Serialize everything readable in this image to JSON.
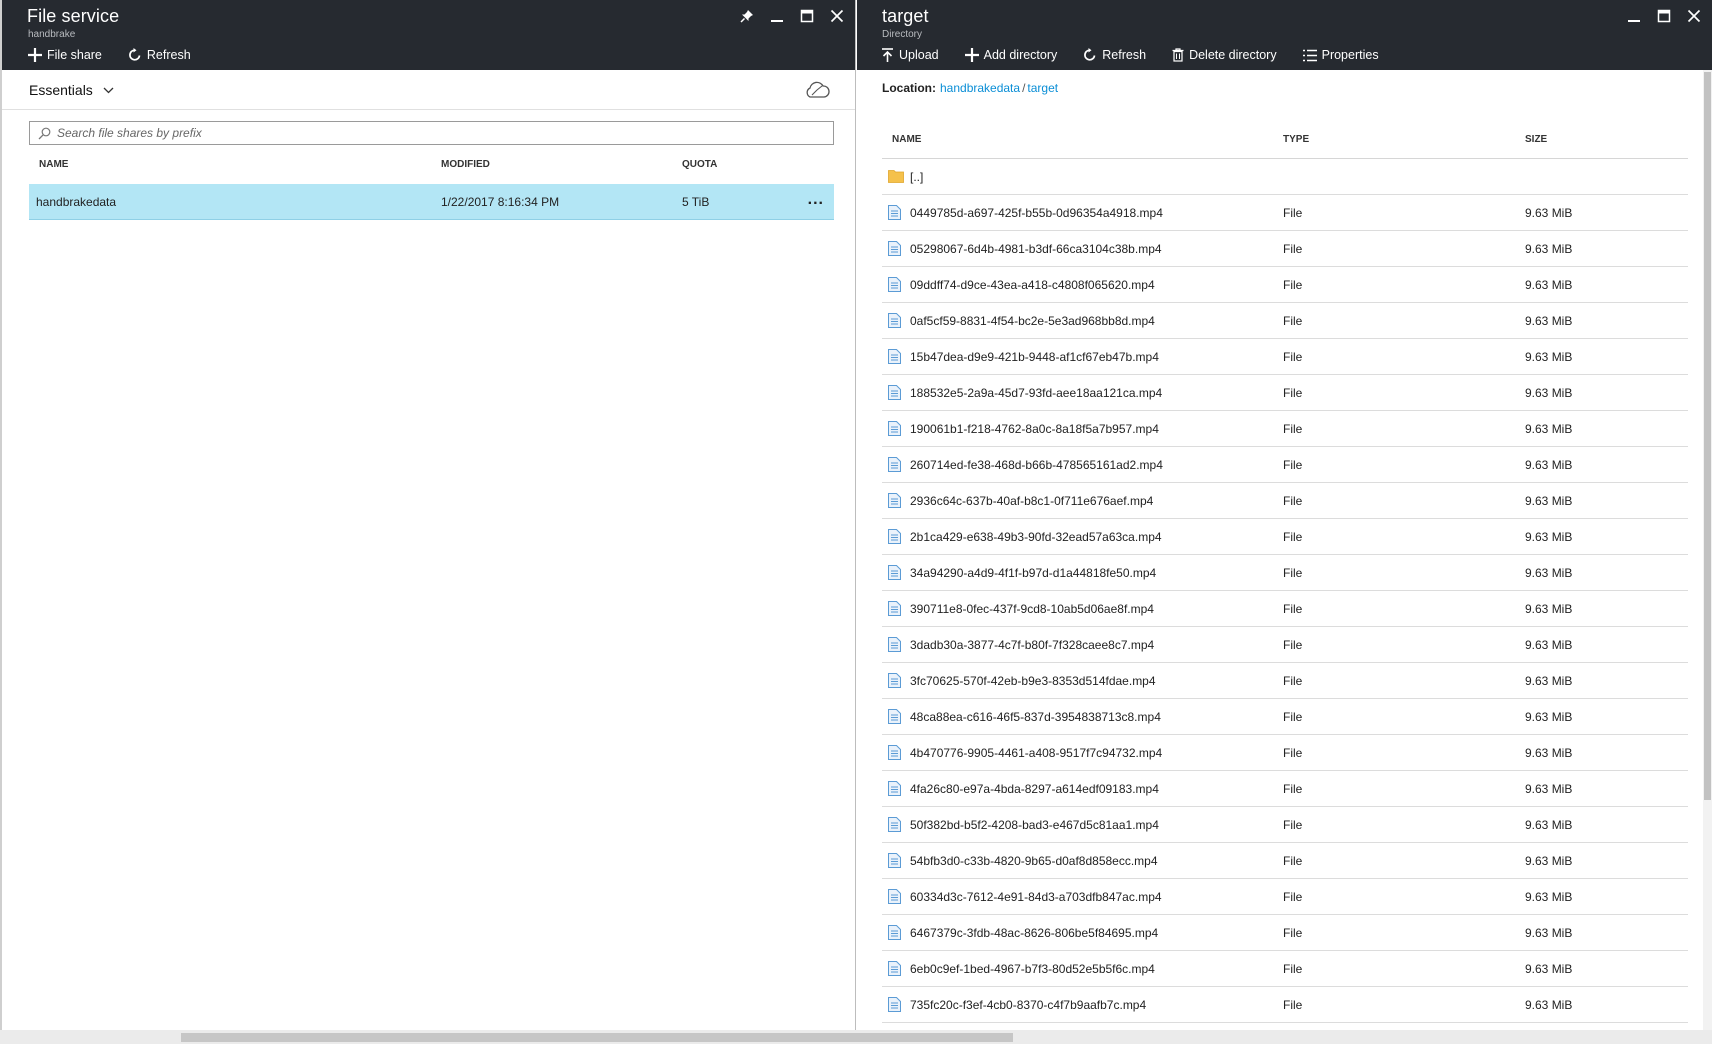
{
  "left_blade": {
    "title": "File service",
    "subtitle": "handbrake",
    "toolbar": {
      "file_share": "File share",
      "refresh": "Refresh"
    },
    "essentials": "Essentials",
    "search_placeholder": "Search file shares by prefix",
    "columns": {
      "name": "NAME",
      "modified": "MODIFIED",
      "quota": "QUOTA"
    },
    "rows": [
      {
        "name": "handbrakedata",
        "modified": "1/22/2017 8:16:34 PM",
        "quota": "5 TiB",
        "more": "..."
      }
    ]
  },
  "right_blade": {
    "title": "target",
    "subtitle": "Directory",
    "toolbar": {
      "upload": "Upload",
      "add_directory": "Add directory",
      "refresh": "Refresh",
      "delete_directory": "Delete directory",
      "properties": "Properties"
    },
    "location": {
      "label": "Location:",
      "segments": [
        "handbrakedata",
        "target"
      ],
      "separator": "/"
    },
    "columns": {
      "name": "NAME",
      "type": "TYPE",
      "size": "SIZE"
    },
    "parent_row": "[..]",
    "files": [
      {
        "name": "0449785d-a697-425f-b55b-0d96354a4918.mp4",
        "type": "File",
        "size": "9.63 MiB"
      },
      {
        "name": "05298067-6d4b-4981-b3df-66ca3104c38b.mp4",
        "type": "File",
        "size": "9.63 MiB"
      },
      {
        "name": "09ddff74-d9ce-43ea-a418-c4808f065620.mp4",
        "type": "File",
        "size": "9.63 MiB"
      },
      {
        "name": "0af5cf59-8831-4f54-bc2e-5e3ad968bb8d.mp4",
        "type": "File",
        "size": "9.63 MiB"
      },
      {
        "name": "15b47dea-d9e9-421b-9448-af1cf67eb47b.mp4",
        "type": "File",
        "size": "9.63 MiB"
      },
      {
        "name": "188532e5-2a9a-45d7-93fd-aee18aa121ca.mp4",
        "type": "File",
        "size": "9.63 MiB"
      },
      {
        "name": "190061b1-f218-4762-8a0c-8a18f5a7b957.mp4",
        "type": "File",
        "size": "9.63 MiB"
      },
      {
        "name": "260714ed-fe38-468d-b66b-478565161ad2.mp4",
        "type": "File",
        "size": "9.63 MiB"
      },
      {
        "name": "2936c64c-637b-40af-b8c1-0f711e676aef.mp4",
        "type": "File",
        "size": "9.63 MiB"
      },
      {
        "name": "2b1ca429-e638-49b3-90fd-32ead57a63ca.mp4",
        "type": "File",
        "size": "9.63 MiB"
      },
      {
        "name": "34a94290-a4d9-4f1f-b97d-d1a44818fe50.mp4",
        "type": "File",
        "size": "9.63 MiB"
      },
      {
        "name": "390711e8-0fec-437f-9cd8-10ab5d06ae8f.mp4",
        "type": "File",
        "size": "9.63 MiB"
      },
      {
        "name": "3dadb30a-3877-4c7f-b80f-7f328caee8c7.mp4",
        "type": "File",
        "size": "9.63 MiB"
      },
      {
        "name": "3fc70625-570f-42eb-b9e3-8353d514fdae.mp4",
        "type": "File",
        "size": "9.63 MiB"
      },
      {
        "name": "48ca88ea-c616-46f5-837d-3954838713c8.mp4",
        "type": "File",
        "size": "9.63 MiB"
      },
      {
        "name": "4b470776-9905-4461-a408-9517f7c94732.mp4",
        "type": "File",
        "size": "9.63 MiB"
      },
      {
        "name": "4fa26c80-e97a-4bda-8297-a614edf09183.mp4",
        "type": "File",
        "size": "9.63 MiB"
      },
      {
        "name": "50f382bd-b5f2-4208-bad3-e467d5c81aa1.mp4",
        "type": "File",
        "size": "9.63 MiB"
      },
      {
        "name": "54bfb3d0-c33b-4820-9b65-d0af8d858ecc.mp4",
        "type": "File",
        "size": "9.63 MiB"
      },
      {
        "name": "60334d3c-7612-4e91-84d3-a703dfb847ac.mp4",
        "type": "File",
        "size": "9.63 MiB"
      },
      {
        "name": "6467379c-3fdb-48ac-8626-806be5f84695.mp4",
        "type": "File",
        "size": "9.63 MiB"
      },
      {
        "name": "6eb0c9ef-1bed-4967-b7f3-80d52e5b5f6c.mp4",
        "type": "File",
        "size": "9.63 MiB"
      },
      {
        "name": "735fc20c-f3ef-4cb0-8370-c4f7b9aafb7c.mp4",
        "type": "File",
        "size": "9.63 MiB"
      }
    ]
  },
  "icons": {
    "pin": "pin-icon",
    "minimize": "minimize-icon",
    "maximize": "maximize-icon",
    "close": "close-icon",
    "plus": "plus-icon",
    "refresh": "refresh-icon",
    "upload": "upload-icon",
    "trash": "trash-icon",
    "properties": "list-icon",
    "folder": "folder-icon",
    "file": "file-icon",
    "search": "search-icon",
    "cloud": "cloud-icon",
    "chevron": "chevron-down-icon"
  },
  "colors": {
    "header_bg": "#262a30",
    "selected_row": "#b3e6f5",
    "link": "#0a8ed6",
    "folder": "#f5c14b",
    "file_icon": "#5b9bd5"
  }
}
